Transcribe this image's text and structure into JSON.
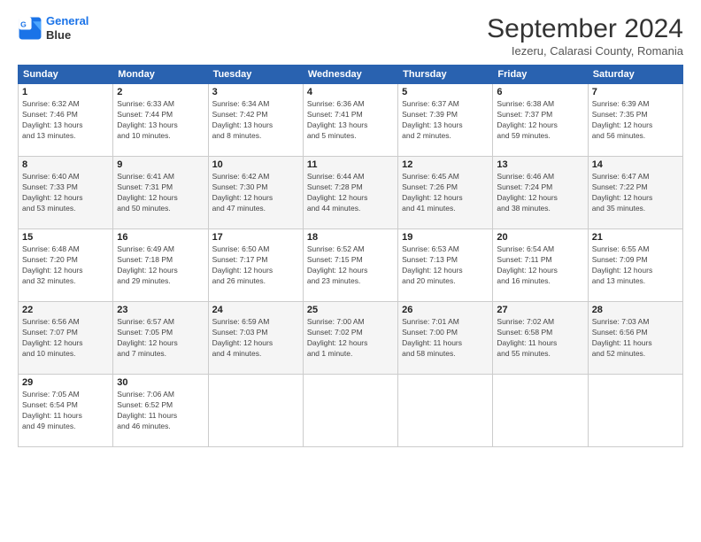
{
  "logo": {
    "line1": "General",
    "line2": "Blue"
  },
  "header": {
    "month": "September 2024",
    "location": "Iezeru, Calarasi County, Romania"
  },
  "weekdays": [
    "Sunday",
    "Monday",
    "Tuesday",
    "Wednesday",
    "Thursday",
    "Friday",
    "Saturday"
  ],
  "weeks": [
    [
      {
        "day": "1",
        "info": "Sunrise: 6:32 AM\nSunset: 7:46 PM\nDaylight: 13 hours\nand 13 minutes."
      },
      {
        "day": "2",
        "info": "Sunrise: 6:33 AM\nSunset: 7:44 PM\nDaylight: 13 hours\nand 10 minutes."
      },
      {
        "day": "3",
        "info": "Sunrise: 6:34 AM\nSunset: 7:42 PM\nDaylight: 13 hours\nand 8 minutes."
      },
      {
        "day": "4",
        "info": "Sunrise: 6:36 AM\nSunset: 7:41 PM\nDaylight: 13 hours\nand 5 minutes."
      },
      {
        "day": "5",
        "info": "Sunrise: 6:37 AM\nSunset: 7:39 PM\nDaylight: 13 hours\nand 2 minutes."
      },
      {
        "day": "6",
        "info": "Sunrise: 6:38 AM\nSunset: 7:37 PM\nDaylight: 12 hours\nand 59 minutes."
      },
      {
        "day": "7",
        "info": "Sunrise: 6:39 AM\nSunset: 7:35 PM\nDaylight: 12 hours\nand 56 minutes."
      }
    ],
    [
      {
        "day": "8",
        "info": "Sunrise: 6:40 AM\nSunset: 7:33 PM\nDaylight: 12 hours\nand 53 minutes."
      },
      {
        "day": "9",
        "info": "Sunrise: 6:41 AM\nSunset: 7:31 PM\nDaylight: 12 hours\nand 50 minutes."
      },
      {
        "day": "10",
        "info": "Sunrise: 6:42 AM\nSunset: 7:30 PM\nDaylight: 12 hours\nand 47 minutes."
      },
      {
        "day": "11",
        "info": "Sunrise: 6:44 AM\nSunset: 7:28 PM\nDaylight: 12 hours\nand 44 minutes."
      },
      {
        "day": "12",
        "info": "Sunrise: 6:45 AM\nSunset: 7:26 PM\nDaylight: 12 hours\nand 41 minutes."
      },
      {
        "day": "13",
        "info": "Sunrise: 6:46 AM\nSunset: 7:24 PM\nDaylight: 12 hours\nand 38 minutes."
      },
      {
        "day": "14",
        "info": "Sunrise: 6:47 AM\nSunset: 7:22 PM\nDaylight: 12 hours\nand 35 minutes."
      }
    ],
    [
      {
        "day": "15",
        "info": "Sunrise: 6:48 AM\nSunset: 7:20 PM\nDaylight: 12 hours\nand 32 minutes."
      },
      {
        "day": "16",
        "info": "Sunrise: 6:49 AM\nSunset: 7:18 PM\nDaylight: 12 hours\nand 29 minutes."
      },
      {
        "day": "17",
        "info": "Sunrise: 6:50 AM\nSunset: 7:17 PM\nDaylight: 12 hours\nand 26 minutes."
      },
      {
        "day": "18",
        "info": "Sunrise: 6:52 AM\nSunset: 7:15 PM\nDaylight: 12 hours\nand 23 minutes."
      },
      {
        "day": "19",
        "info": "Sunrise: 6:53 AM\nSunset: 7:13 PM\nDaylight: 12 hours\nand 20 minutes."
      },
      {
        "day": "20",
        "info": "Sunrise: 6:54 AM\nSunset: 7:11 PM\nDaylight: 12 hours\nand 16 minutes."
      },
      {
        "day": "21",
        "info": "Sunrise: 6:55 AM\nSunset: 7:09 PM\nDaylight: 12 hours\nand 13 minutes."
      }
    ],
    [
      {
        "day": "22",
        "info": "Sunrise: 6:56 AM\nSunset: 7:07 PM\nDaylight: 12 hours\nand 10 minutes."
      },
      {
        "day": "23",
        "info": "Sunrise: 6:57 AM\nSunset: 7:05 PM\nDaylight: 12 hours\nand 7 minutes."
      },
      {
        "day": "24",
        "info": "Sunrise: 6:59 AM\nSunset: 7:03 PM\nDaylight: 12 hours\nand 4 minutes."
      },
      {
        "day": "25",
        "info": "Sunrise: 7:00 AM\nSunset: 7:02 PM\nDaylight: 12 hours\nand 1 minute."
      },
      {
        "day": "26",
        "info": "Sunrise: 7:01 AM\nSunset: 7:00 PM\nDaylight: 11 hours\nand 58 minutes."
      },
      {
        "day": "27",
        "info": "Sunrise: 7:02 AM\nSunset: 6:58 PM\nDaylight: 11 hours\nand 55 minutes."
      },
      {
        "day": "28",
        "info": "Sunrise: 7:03 AM\nSunset: 6:56 PM\nDaylight: 11 hours\nand 52 minutes."
      }
    ],
    [
      {
        "day": "29",
        "info": "Sunrise: 7:05 AM\nSunset: 6:54 PM\nDaylight: 11 hours\nand 49 minutes."
      },
      {
        "day": "30",
        "info": "Sunrise: 7:06 AM\nSunset: 6:52 PM\nDaylight: 11 hours\nand 46 minutes."
      },
      {
        "day": "",
        "info": ""
      },
      {
        "day": "",
        "info": ""
      },
      {
        "day": "",
        "info": ""
      },
      {
        "day": "",
        "info": ""
      },
      {
        "day": "",
        "info": ""
      }
    ]
  ]
}
